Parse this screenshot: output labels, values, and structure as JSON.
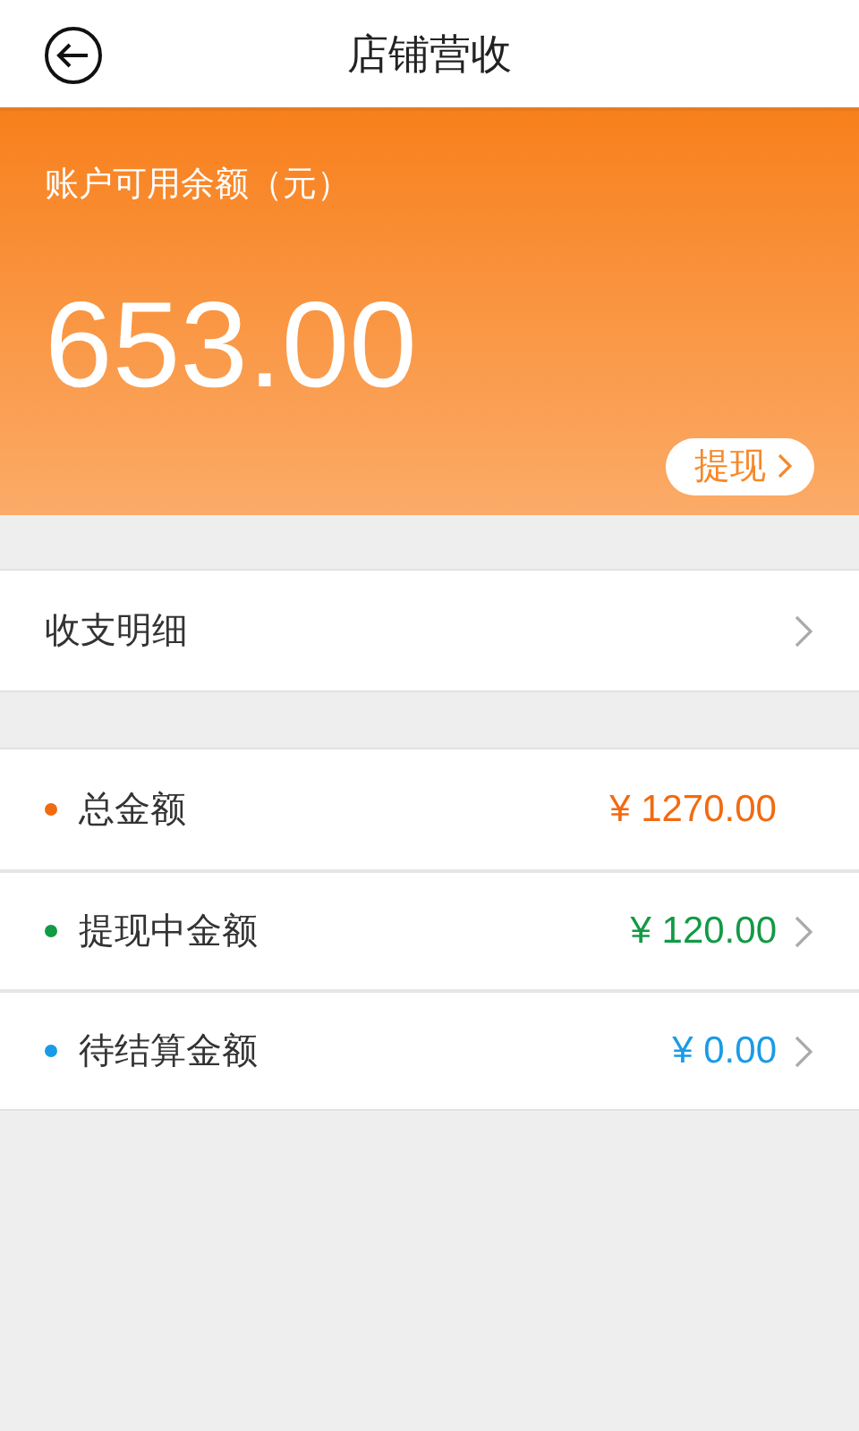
{
  "header": {
    "title": "店铺营收"
  },
  "balance": {
    "label": "账户可用余额（元）",
    "amount": "653.00",
    "button": "提现"
  },
  "detail_link": {
    "label": "收支明细"
  },
  "summary": [
    {
      "label": "总金额",
      "amount": "¥ 1270.00",
      "color": "#f26a10",
      "chevron": false
    },
    {
      "label": "提现中金额",
      "amount": "¥ 120.00",
      "color": "#129a45",
      "chevron": true
    },
    {
      "label": "待结算金额",
      "amount": "¥ 0.00",
      "color": "#1a9be6",
      "chevron": true
    }
  ]
}
